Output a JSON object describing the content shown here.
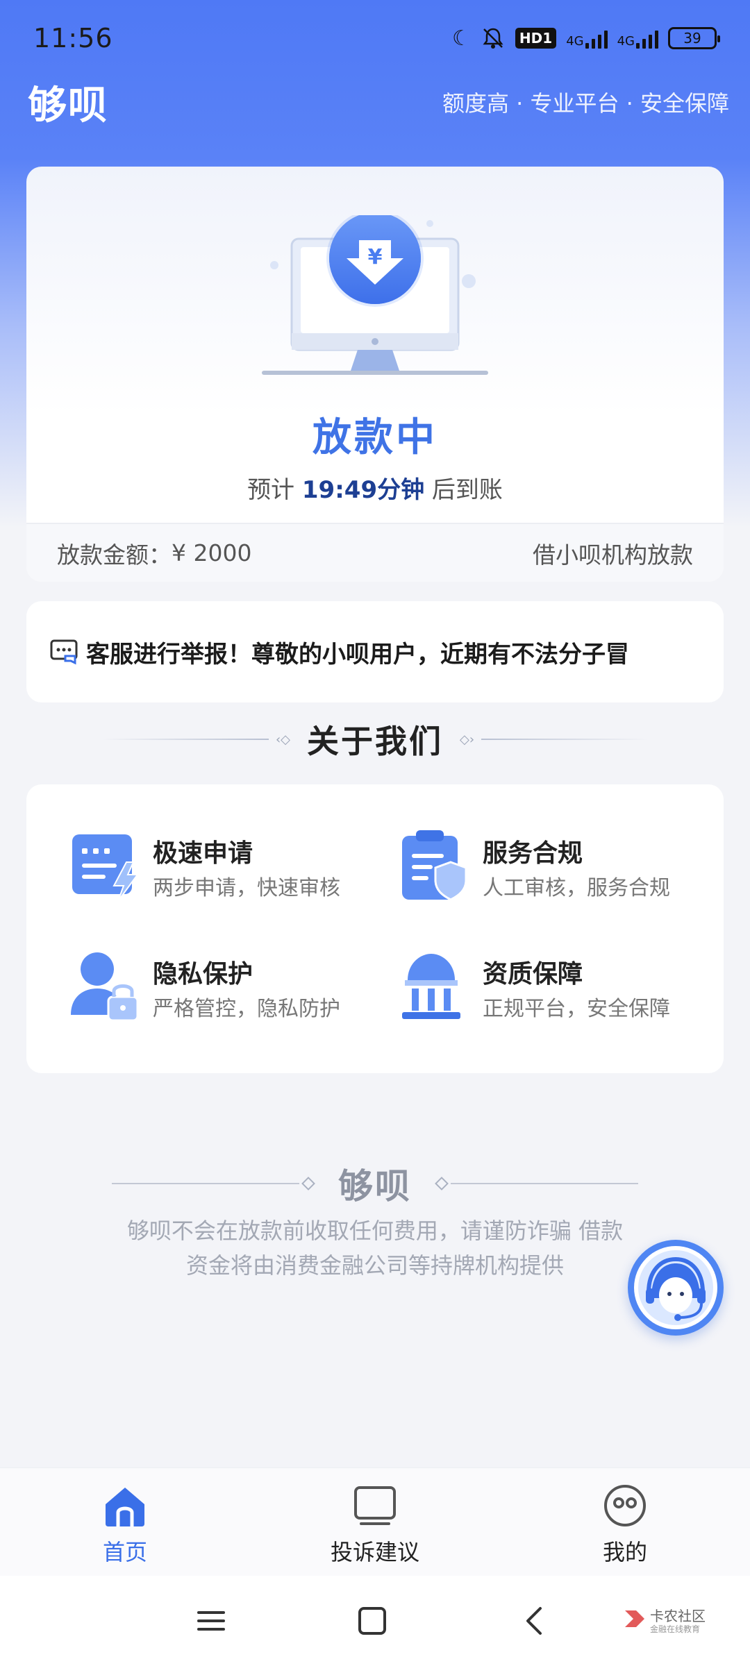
{
  "status_bar": {
    "time": "11:56",
    "hd_badge": "HD1",
    "network_1": "4G",
    "network_2": "4G",
    "battery": "39",
    "icons": [
      "moon-icon",
      "mute-icon"
    ]
  },
  "header": {
    "logo": "够呗",
    "tagline": "额度高 · 专业平台 · 安全保障"
  },
  "loan_card": {
    "status": "放款中",
    "eta_prefix": "预计",
    "eta_time": "19:49分钟",
    "eta_suffix": "后到账",
    "amount_label": "放款金额：",
    "amount_value": "¥ 2000",
    "lender_note": "借小呗机构放款",
    "accent_color": "#3f73e6"
  },
  "notice": {
    "text": "客服进行举报！尊敬的小呗用户，近期有不法分子冒"
  },
  "about": {
    "title": "关于我们",
    "features": [
      {
        "title": "极速申请",
        "desc": "两步申请，快速审核",
        "icon": "form-lightning-icon"
      },
      {
        "title": "服务合规",
        "desc": "人工审核，服务合规",
        "icon": "clipboard-shield-icon"
      },
      {
        "title": "隐私保护",
        "desc": "严格管控，隐私防护",
        "icon": "user-lock-icon"
      },
      {
        "title": "资质保障",
        "desc": "正规平台，安全保障",
        "icon": "building-icon"
      }
    ]
  },
  "footer_brand": {
    "name": "够呗",
    "disclaimer_line1": "够呗不会在放款前收取任何费用，请谨防诈骗 借款",
    "disclaimer_line2": "资金将由消费金融公司等持牌机构提供"
  },
  "tab_bar": {
    "tabs": [
      {
        "label": "首页",
        "icon": "home-icon",
        "active": true
      },
      {
        "label": "投诉建议",
        "icon": "feedback-icon",
        "active": false
      },
      {
        "label": "我的",
        "icon": "profile-icon",
        "active": false
      }
    ]
  },
  "watermark": {
    "title": "卡农社区",
    "subtitle": "金融在线教育"
  }
}
